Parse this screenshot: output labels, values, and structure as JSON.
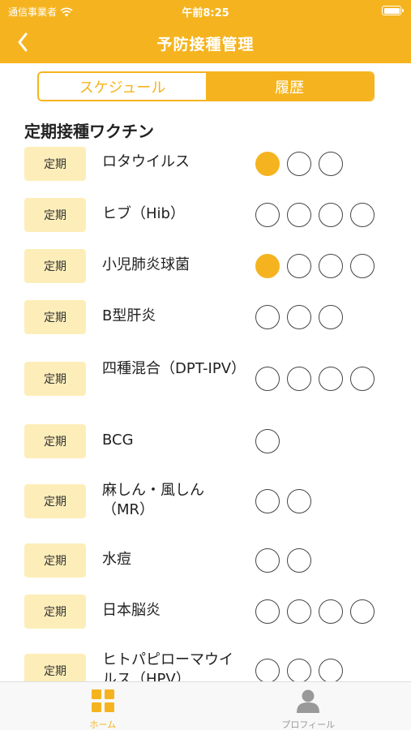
{
  "status_bar": {
    "carrier": "通信事業者",
    "time": "午前8:25"
  },
  "nav": {
    "title": "予防接種管理"
  },
  "segments": [
    {
      "label": "スケジュール",
      "active": true
    },
    {
      "label": "履歴",
      "active": false
    }
  ],
  "section_title": "定期接種ワクチン",
  "vaccines": [
    {
      "badge": "定期",
      "name": "ロタウイルス",
      "doses": [
        true,
        false,
        false
      ]
    },
    {
      "badge": "定期",
      "name": "ヒブ（Hib）",
      "doses": [
        false,
        false,
        false,
        false
      ]
    },
    {
      "badge": "定期",
      "name": "小児肺炎球菌",
      "doses": [
        true,
        false,
        false,
        false
      ]
    },
    {
      "badge": "定期",
      "name": "B型肝炎",
      "doses": [
        false,
        false,
        false
      ]
    },
    {
      "badge": "定期",
      "name": "四種混合（DPT-IPV）",
      "doses": [
        false,
        false,
        false,
        false
      ]
    },
    {
      "badge": "定期",
      "name": "BCG",
      "doses": [
        false
      ]
    },
    {
      "badge": "定期",
      "name": "麻しん・風しん（MR）",
      "doses": [
        false,
        false
      ]
    },
    {
      "badge": "定期",
      "name": "水痘",
      "doses": [
        false,
        false
      ]
    },
    {
      "badge": "定期",
      "name": "日本脳炎",
      "doses": [
        false,
        false,
        false,
        false
      ]
    },
    {
      "badge": "定期",
      "name": "ヒトパピローマウイルス（HPV）",
      "doses": [
        false,
        false,
        false
      ]
    }
  ],
  "tabs": [
    {
      "label": "ホーム",
      "icon": "home-grid-icon",
      "active": true
    },
    {
      "label": "プロフィール",
      "icon": "person-icon",
      "active": false
    }
  ],
  "colors": {
    "accent": "#f5b41f",
    "badge_bg": "#fdeeb9"
  }
}
